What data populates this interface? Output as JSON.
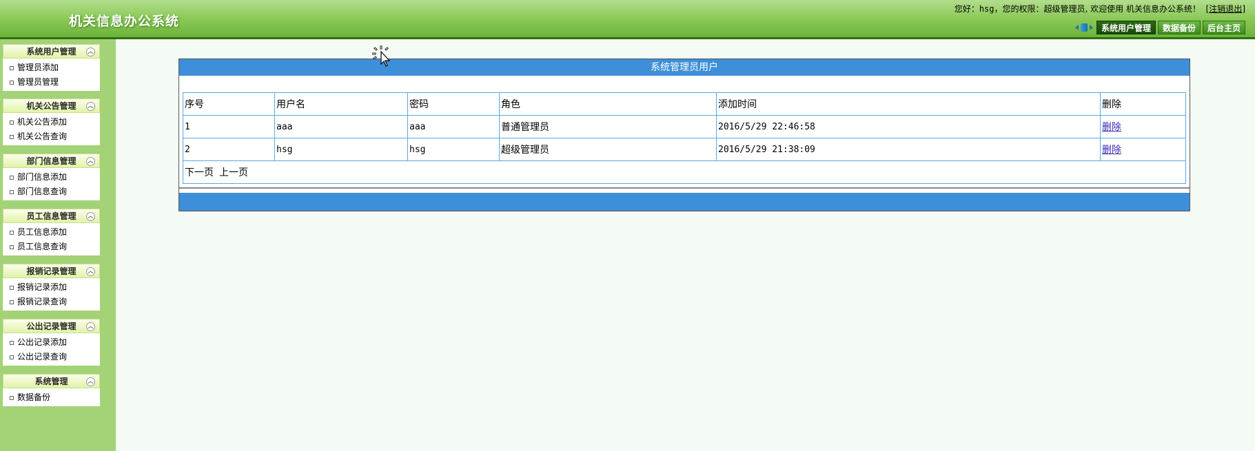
{
  "header": {
    "app_title": "机关信息办公系统",
    "welcome_prefix": "您好：",
    "username": "hsg",
    "welcome_mid": "，您的权限：超级管理员, 欢迎使用 机关信息办公系统！",
    "logout_open": "[",
    "logout_label": "注销退出",
    "logout_close": "]",
    "nav": [
      {
        "label": "系统用户管理",
        "active": true
      },
      {
        "label": "数据备份"
      },
      {
        "label": "后台主页"
      }
    ]
  },
  "sidebar": {
    "groups": [
      {
        "title": "系统用户管理",
        "items": [
          "管理员添加",
          "管理员管理"
        ]
      },
      {
        "title": "机关公告管理",
        "items": [
          "机关公告添加",
          "机关公告查询"
        ]
      },
      {
        "title": "部门信息管理",
        "items": [
          "部门信息添加",
          "部门信息查询"
        ]
      },
      {
        "title": "员工信息管理",
        "items": [
          "员工信息添加",
          "员工信息查询"
        ]
      },
      {
        "title": "报销记录管理",
        "items": [
          "报销记录添加",
          "报销记录查询"
        ]
      },
      {
        "title": "公出记录管理",
        "items": [
          "公出记录添加",
          "公出记录查询"
        ]
      },
      {
        "title": "系统管理",
        "items": [
          "数据备份"
        ]
      }
    ]
  },
  "main": {
    "panel_title": "系统管理员用户",
    "columns": [
      "序号",
      "用户名",
      "密码",
      "角色",
      "添加时间",
      "删除"
    ],
    "rows": [
      {
        "index": "1",
        "username": "aaa",
        "password": "aaa",
        "role": "普通管理员",
        "added": "2016/5/29 22:46:58",
        "delete": "删除"
      },
      {
        "index": "2",
        "username": "hsg",
        "password": "hsg",
        "role": "超级管理员",
        "added": "2016/5/29 21:38:09",
        "delete": "删除"
      }
    ],
    "pager": {
      "next": "下一页",
      "prev": "上一页"
    }
  },
  "colors": {
    "header_green": "#6bb33a",
    "sidebar_green": "#a3d277",
    "panel_blue": "#3d8fd9",
    "grid_border": "#5ca6e0",
    "link": "#3b28b4"
  }
}
